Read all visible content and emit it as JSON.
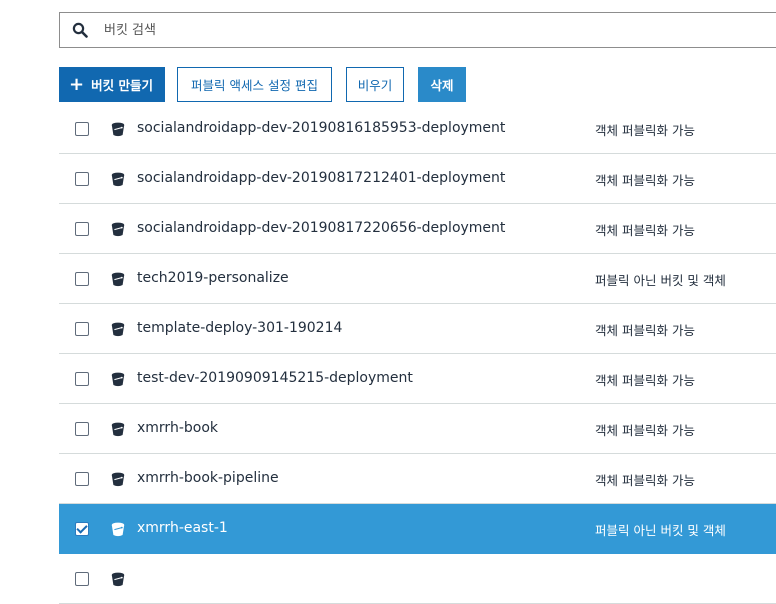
{
  "search": {
    "placeholder": "버킷 검색"
  },
  "toolbar": {
    "create_label": "버킷 만들기",
    "edit_public_label": "퍼블릭 액세스 설정 편집",
    "empty_label": "비우기",
    "delete_label": "삭제"
  },
  "buckets": [
    {
      "name": "socialandroidapp-dev-20190816185953-deployment",
      "access": "객체 퍼블릭화 가능",
      "checked": false
    },
    {
      "name": "socialandroidapp-dev-20190817212401-deployment",
      "access": "객체 퍼블릭화 가능",
      "checked": false
    },
    {
      "name": "socialandroidapp-dev-20190817220656-deployment",
      "access": "객체 퍼블릭화 가능",
      "checked": false
    },
    {
      "name": "tech2019-personalize",
      "access": "퍼블릭 아닌 버킷 및 객체",
      "checked": false
    },
    {
      "name": "template-deploy-301-190214",
      "access": "객체 퍼블릭화 가능",
      "checked": false
    },
    {
      "name": "test-dev-20190909145215-deployment",
      "access": "객체 퍼블릭화 가능",
      "checked": false
    },
    {
      "name": "xmrrh-book",
      "access": "객체 퍼블릭화 가능",
      "checked": false
    },
    {
      "name": "xmrrh-book-pipeline",
      "access": "객체 퍼블릭화 가능",
      "checked": false
    },
    {
      "name": "xmrrh-east-1",
      "access": "퍼블릭 아닌 버킷 및 객체",
      "checked": true
    },
    {
      "name": "",
      "access": "",
      "checked": false
    }
  ],
  "colors": {
    "primary": "#1168b0",
    "selected_row": "#3399d6"
  },
  "icons": {
    "search": "search-icon",
    "bucket": "bucket-icon"
  }
}
